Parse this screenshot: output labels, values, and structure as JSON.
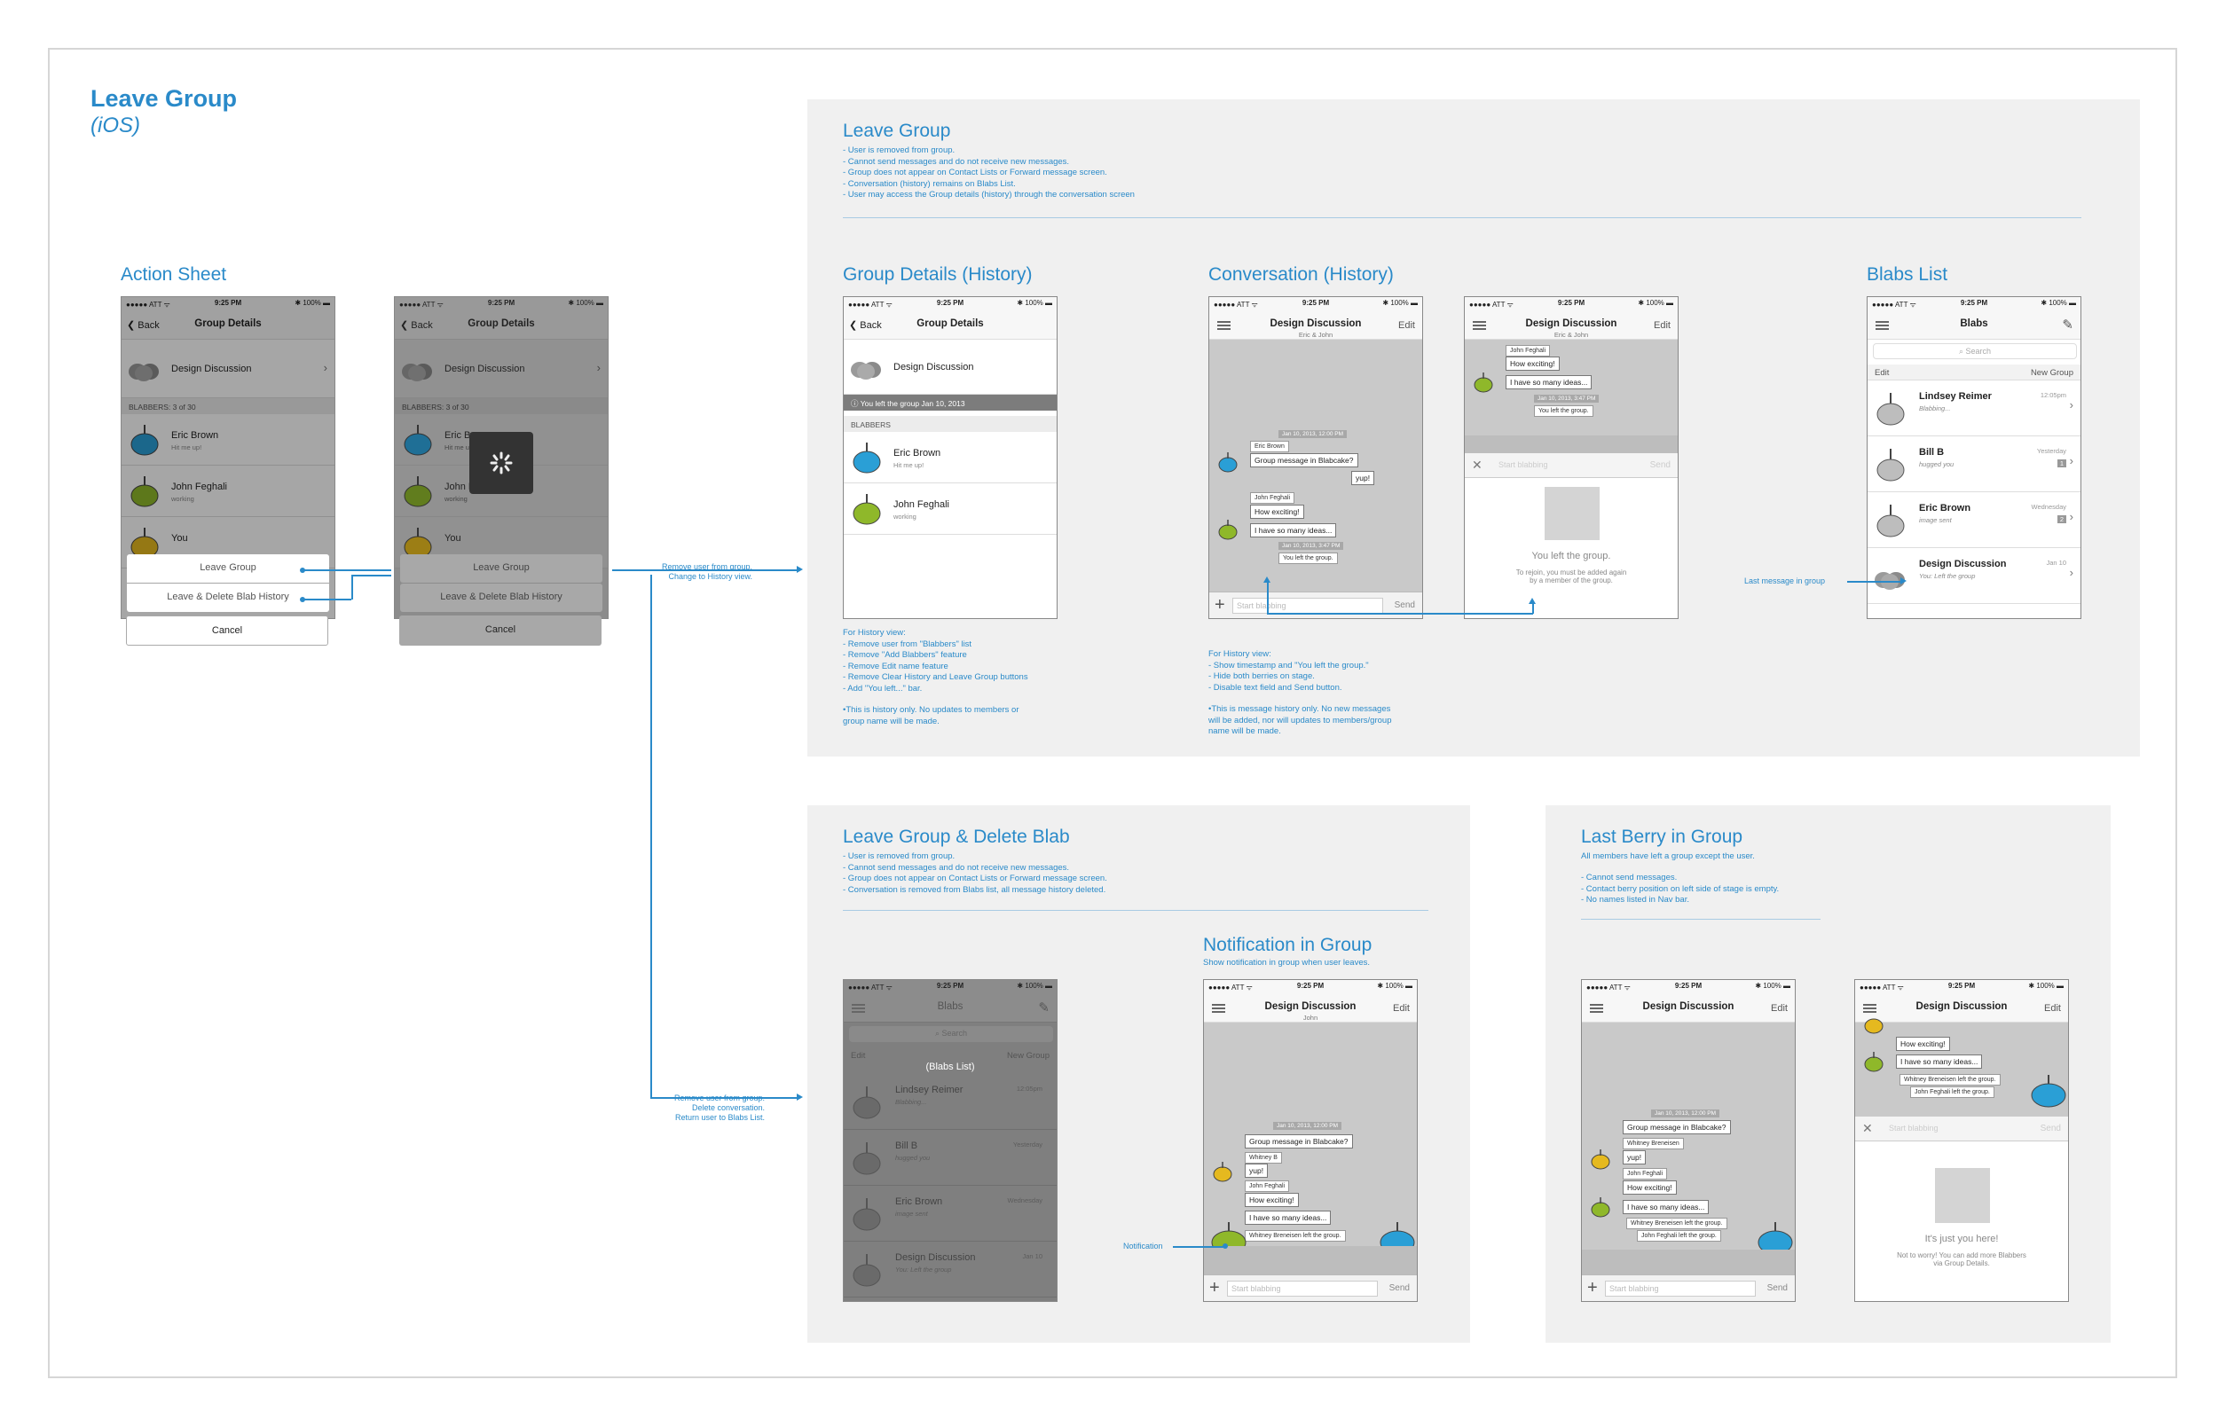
{
  "doc": {
    "title": "Leave Group",
    "subtitle": "(iOS)"
  },
  "status": {
    "carrier": "●●●●● ATT ᯤ",
    "time": "9:25 PM",
    "battery": "✱ 100% ▬"
  },
  "action_sheet": {
    "heading": "Action Sheet",
    "back": "Back",
    "nav_title": "Group Details",
    "group_name": "Design Discussion",
    "section": "BLABBERS: 3 of 30",
    "members": [
      {
        "name": "Eric Brown",
        "status": "Hit me up!"
      },
      {
        "name": "John Feghali",
        "status": "working"
      },
      {
        "name": "You",
        "status": ""
      }
    ],
    "leave": "Leave Group",
    "leave_delete": "Leave & Delete Blab History",
    "cancel": "Cancel"
  },
  "leave_group": {
    "heading": "Leave Group",
    "notes": [
      "- User is removed from group.",
      "- Cannot send messages and do not receive new messages.",
      "- Group does not appear on Contact Lists or Forward message screen.",
      "- Conversation (history) remains on Blabs List.",
      "- User may access the Group details (history) through the conversation screen"
    ]
  },
  "group_details_history": {
    "heading": "Group Details (History)",
    "banner": "You left the group Jan 10, 2013",
    "section": "BLABBERS",
    "notes": [
      "For History view:",
      "- Remove user from \"Blabbers\" list",
      "- Remove \"Add Blabbers\" feature",
      "- Remove Edit name feature",
      "- Remove Clear History and Leave Group buttons",
      "- Add \"You left...\" bar.",
      "",
      "•This is history only. No updates to members or",
      "group name will be made."
    ]
  },
  "conversation_history": {
    "heading": "Conversation (History)",
    "nav_sub": "Eric & John",
    "edit": "Edit",
    "timestamp1": "Jan 10, 2013, 12:00 PM",
    "timestamp2": "Jan 10, 2013, 3:47 PM",
    "messages": [
      {
        "from": "Eric Brown",
        "text": "Group message in Blabcake?"
      },
      {
        "from": "",
        "text": "yup!"
      },
      {
        "from": "John Feghali",
        "text": "How exciting!"
      },
      {
        "from": "",
        "text": "I have so many ideas..."
      }
    ],
    "left_bubble": "You left the group.",
    "input_placeholder": "Start blabbing",
    "send": "Send",
    "left_title": "You left the group.",
    "left_body": "To rejoin, you must be added again\nby a member of the group.",
    "notes": [
      "For History view:",
      "- Show timestamp and \"You left the group.\"",
      "- Hide both berries on stage.",
      "- Disable text field and Send button.",
      "",
      "•This is message history only. No new messages",
      "will be added, nor will updates to members/group",
      "name will be made."
    ]
  },
  "blabs_list": {
    "heading": "Blabs List",
    "nav_title": "Blabs",
    "search": "Search",
    "edit": "Edit",
    "new_group": "New Group",
    "items": [
      {
        "name": "Lindsey Reimer",
        "sub": "Blabbing...",
        "time": "12:05pm",
        "count": ""
      },
      {
        "name": "Bill B",
        "sub": "hugged you",
        "time": "Yesterday",
        "count": "1"
      },
      {
        "name": "Eric Brown",
        "sub": "image sent",
        "time": "Wednesday",
        "count": "2"
      },
      {
        "name": "Design Discussion",
        "sub": "You: Left the group",
        "time": "Jan 10",
        "count": ""
      }
    ],
    "annotation": "Last message in group"
  },
  "flow_labels": {
    "history": "Remove user from group.\nChange to History view.",
    "delete": "Remove user from group.\nDelete conversation.\nReturn user to Blabs List."
  },
  "leave_delete": {
    "heading": "Leave Group & Delete Blab",
    "notes": [
      "- User is removed from group.",
      "- Cannot send messages and do not receive new messages.",
      "- Group does not appear on Contact Lists or Forward message screen.",
      "- Conversation is removed from Blabs list, all message history deleted."
    ],
    "overlay": "(Blabs List)"
  },
  "notification": {
    "heading": "Notification in Group",
    "sub": "Show notification in group when user leaves.",
    "nav_sub": "John",
    "whitney": "Whitney B",
    "notice": "Whitney Breneisen left the group.",
    "annotation": "Notification"
  },
  "last_berry": {
    "heading": "Last Berry in Group",
    "sub": "All members have left a group except the user.",
    "notes": [
      "- Cannot send messages.",
      "- Contact berry position on left side of stage is empty.",
      "- No names listed in Nav bar."
    ],
    "whitney": "Whitney Breneisen",
    "notice1": "Whitney Breneisen left the group.",
    "notice2": "John Feghali left the group.",
    "alone_title": "It's just you here!",
    "alone_body": "Not to worry! You can add more Blabbers\nvia Group Details."
  },
  "colors": {
    "accent": "#2a8ac9",
    "berry_blue": "#2a9fd6",
    "berry_green": "#8fb82a",
    "berry_yellow": "#e5b91f",
    "berry_gray": "#9a9a9a"
  }
}
